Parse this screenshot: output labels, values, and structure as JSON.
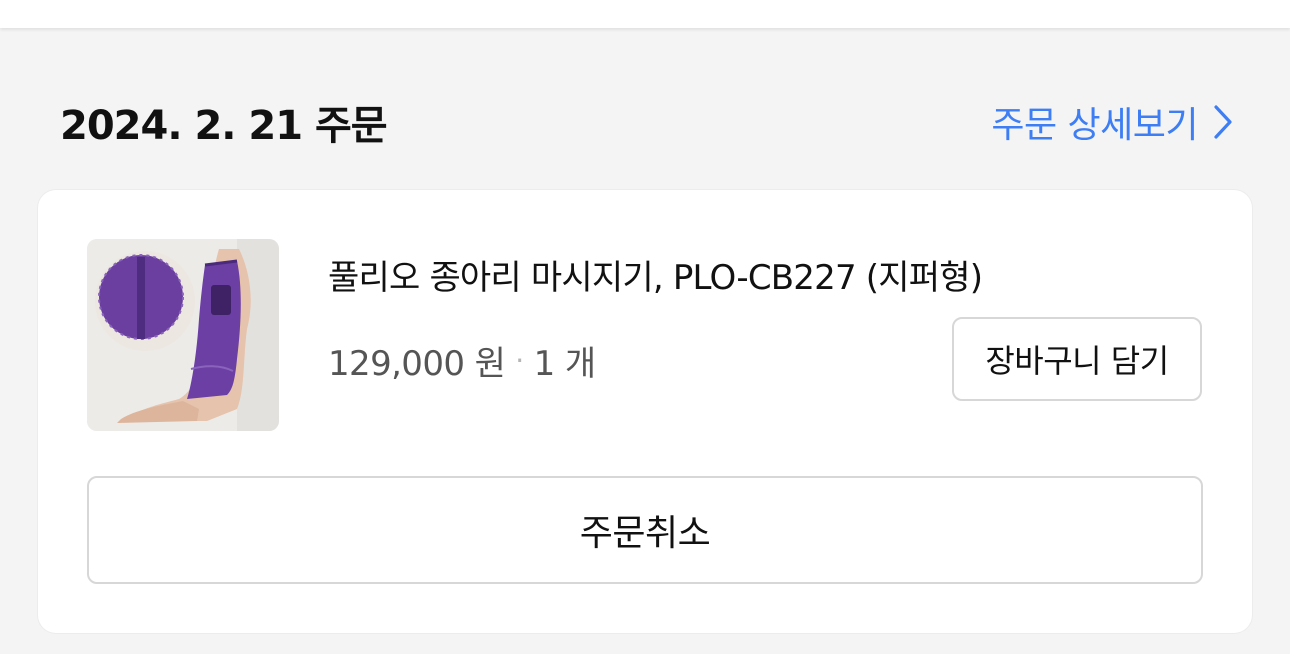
{
  "order": {
    "date_title": "2024. 2. 21 주문",
    "detail_link_label": "주문 상세보기"
  },
  "item": {
    "name": "풀리오 종아리 마시지기, PLO-CB227 (지퍼형)",
    "price": "129,000 원",
    "separator": "·",
    "quantity": "1 개",
    "image_icon": "product-photo-leg-massager"
  },
  "actions": {
    "add_to_cart_label": "장바구니 담기",
    "cancel_order_label": "주문취소"
  },
  "colors": {
    "accent": "#3e7ef4",
    "background": "#f4f4f4",
    "card": "#ffffff",
    "product_purple": "#6a3fa0"
  }
}
